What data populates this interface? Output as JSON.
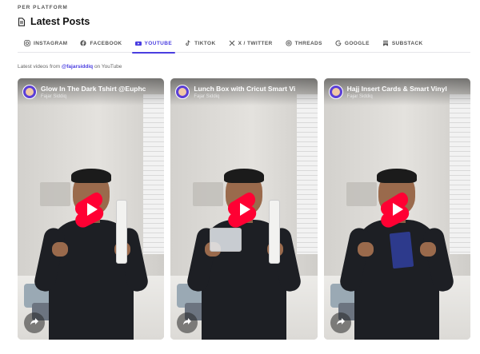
{
  "header": {
    "eyebrow": "PER PLATFORM",
    "title": "Latest Posts",
    "title_icon": "document-icon"
  },
  "tabs": [
    {
      "label": "INSTAGRAM",
      "icon": "instagram-icon",
      "active": false
    },
    {
      "label": "FACEBOOK",
      "icon": "facebook-icon",
      "active": false
    },
    {
      "label": "YOUTUBE",
      "icon": "youtube-icon",
      "active": true
    },
    {
      "label": "TIKTOK",
      "icon": "tiktok-icon",
      "active": false
    },
    {
      "label": "X / TWITTER",
      "icon": "x-icon",
      "active": false
    },
    {
      "label": "THREADS",
      "icon": "threads-icon",
      "active": false
    },
    {
      "label": "GOOGLE",
      "icon": "google-icon",
      "active": false
    },
    {
      "label": "SUBSTACK",
      "icon": "substack-icon",
      "active": false
    }
  ],
  "subtitle": {
    "prefix": "Latest videos from ",
    "handle": "@fajarsiddiq",
    "suffix": " on YouTube"
  },
  "videos": [
    {
      "title": "Glow In The Dark Tshirt @Euphc",
      "channel": "Fajar Siddiq",
      "prop": "bottle"
    },
    {
      "title": "Lunch Box with Cricut Smart Vi",
      "channel": "Fajar Siddiq",
      "prop": "box"
    },
    {
      "title": "Hajj Insert Cards & Smart Vinyl",
      "channel": "Fajar Siddiq",
      "prop": "card"
    }
  ],
  "colors": {
    "accent": "#4a3ee0",
    "shorts_red": "#ff0033"
  }
}
